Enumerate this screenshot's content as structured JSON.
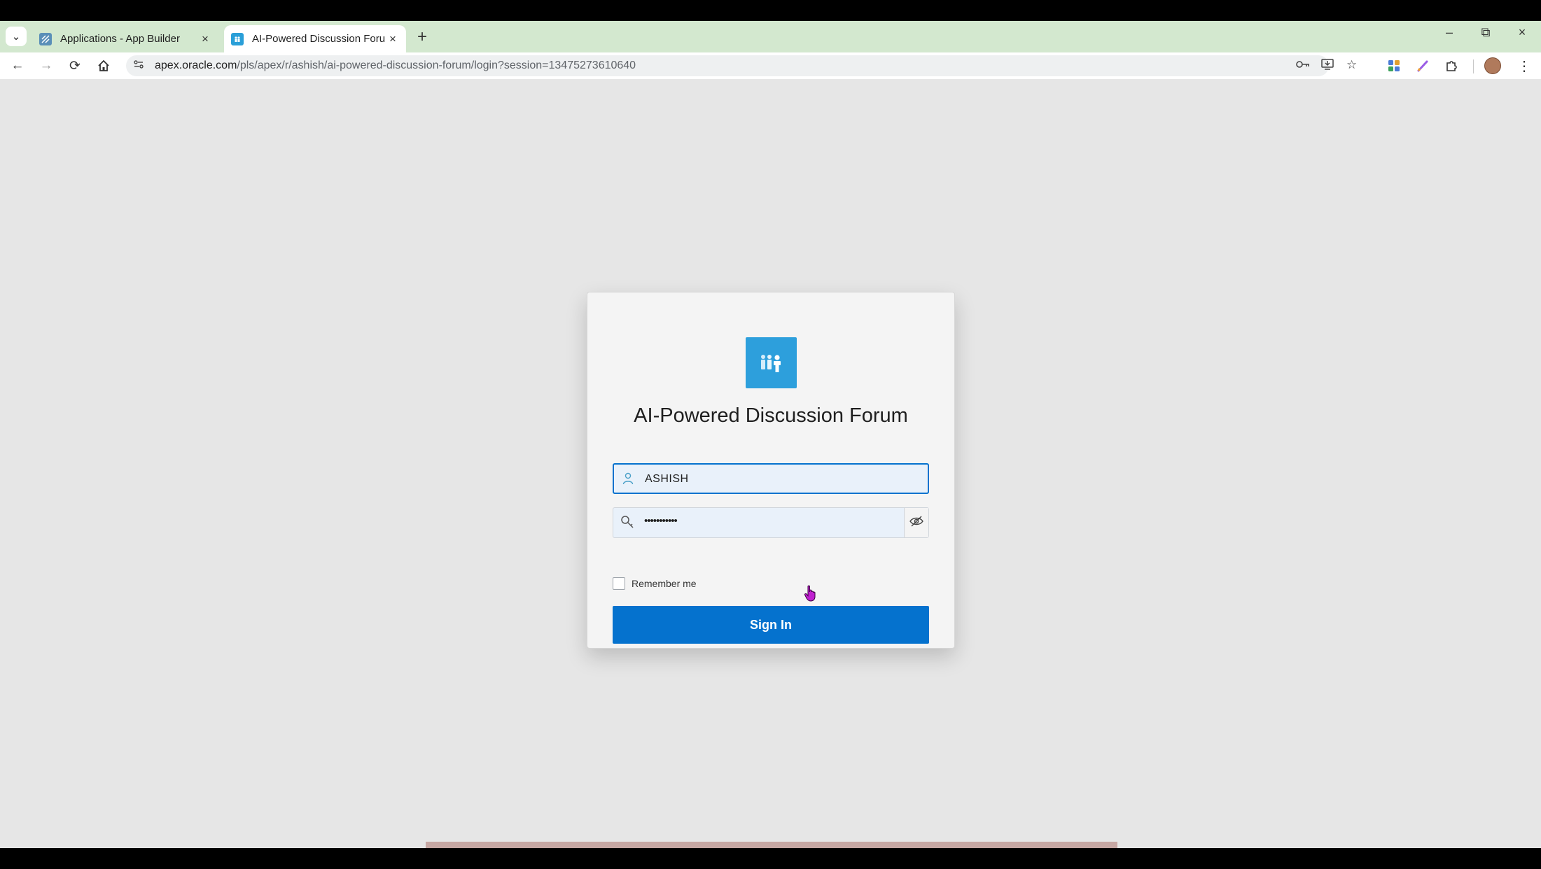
{
  "browser": {
    "tabs": [
      {
        "title": "Applications - App Builder",
        "active": false
      },
      {
        "title": "AI-Powered Discussion Forum -",
        "active": true
      }
    ],
    "tab_close_glyph": "×",
    "new_tab_glyph": "+",
    "window_controls": {
      "minimize": "–",
      "restore": "⧉",
      "close": "×"
    },
    "url": {
      "host": "apex.oracle.com",
      "path": "/pls/apex/r/ashish/ai-powered-discussion-forum/login?session=13475273610640"
    }
  },
  "login": {
    "app_title": "AI-Powered Discussion Forum",
    "username": "ASHISH",
    "password_masked": "•••••••••••",
    "remember_label": "Remember me",
    "remember_checked": false,
    "sign_in_label": "Sign In"
  },
  "colors": {
    "primary": "#0572ce",
    "app_icon": "#2d9fdc",
    "tabstrip": "#d3e8cf",
    "page_bg": "#e6e6e6"
  }
}
